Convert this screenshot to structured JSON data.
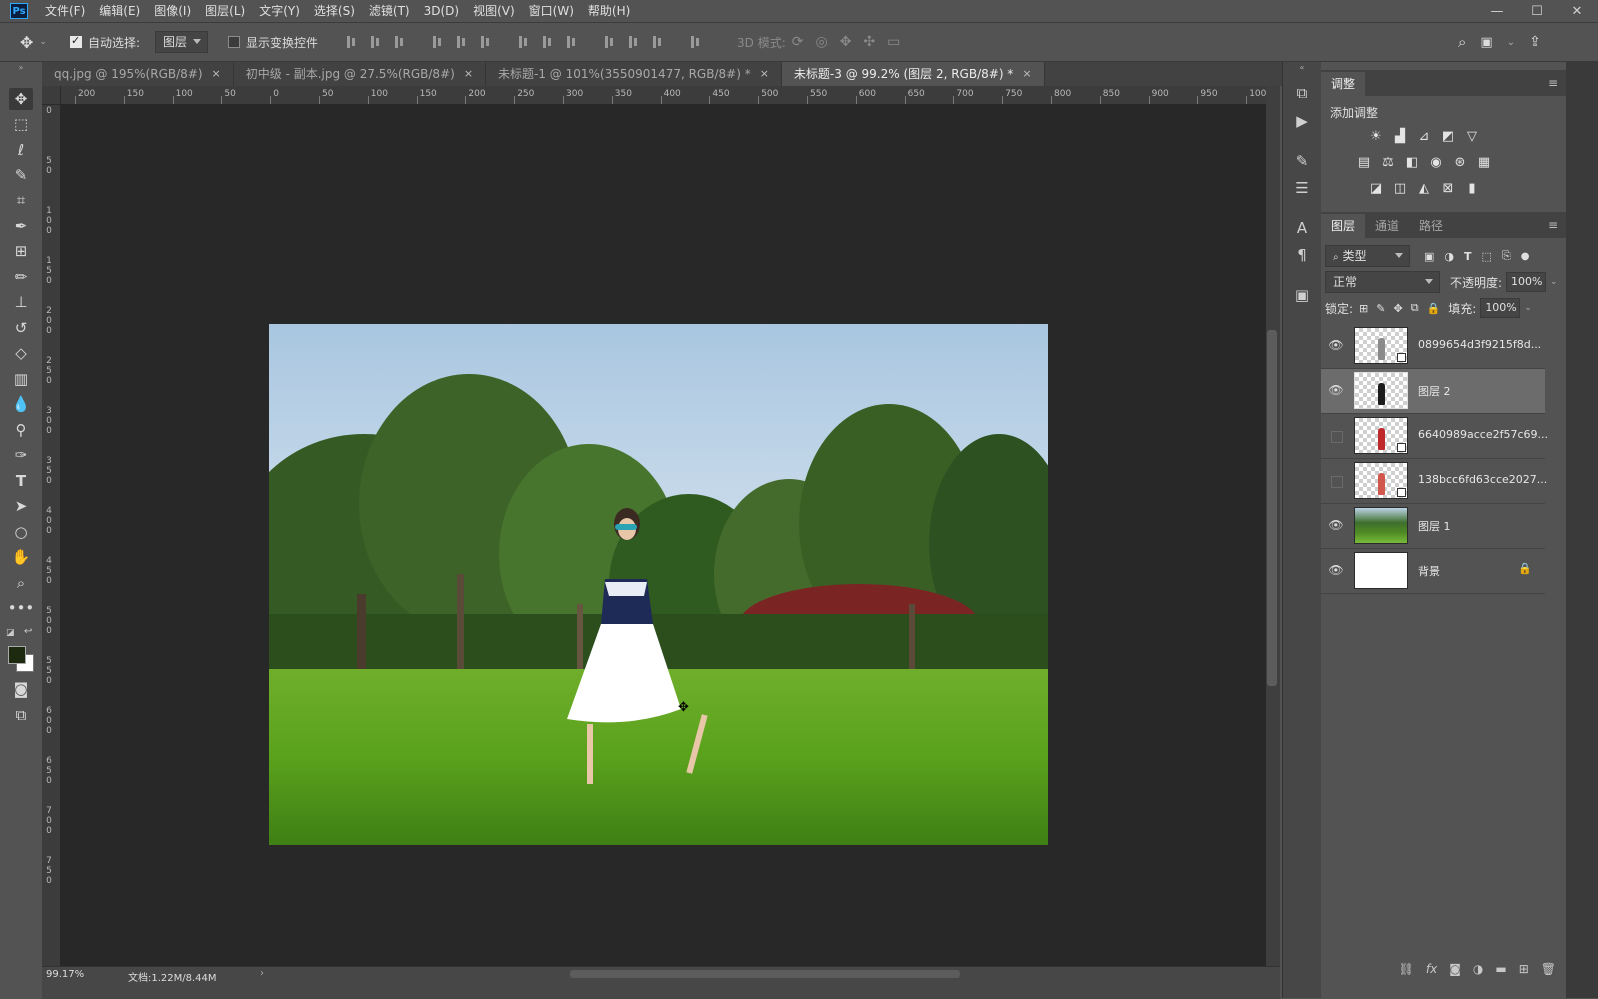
{
  "menubar": {
    "logo": "Ps",
    "items": [
      "文件(F)",
      "编辑(E)",
      "图像(I)",
      "图层(L)",
      "文字(Y)",
      "选择(S)",
      "滤镜(T)",
      "3D(D)",
      "视图(V)",
      "窗口(W)",
      "帮助(H)"
    ],
    "window_controls": [
      "—",
      "☐",
      "✕"
    ]
  },
  "options": {
    "auto_select_label": "自动选择:",
    "auto_select_checked": true,
    "auto_select_target": "图层",
    "show_transform_label": "显示变换控件",
    "show_transform_checked": false,
    "mode_3d_label": "3D 模式:"
  },
  "tabs": [
    {
      "label": "qq.jpg @ 195%(RGB/8#)",
      "close": "×",
      "active": false
    },
    {
      "label": "初中级 - 副本.jpg @ 27.5%(RGB/8#)",
      "close": "×",
      "active": false
    },
    {
      "label": "未标题-1 @ 101%(3550901477, RGB/8#) *",
      "close": "×",
      "active": false
    },
    {
      "label": "未标题-3 @ 99.2% (图层 2, RGB/8#) *",
      "close": "×",
      "active": true
    }
  ],
  "ruler": {
    "top_labels": [
      "200",
      "150",
      "100",
      "50",
      "0",
      "50",
      "100",
      "150",
      "200",
      "250",
      "300",
      "350",
      "400",
      "450",
      "500",
      "550",
      "600",
      "650",
      "700",
      "750",
      "800",
      "850",
      "900",
      "950",
      "100"
    ],
    "left_labels": [
      "0",
      "5\n0",
      "1\n0\n0",
      "1\n5\n0",
      "2\n0\n0",
      "2\n5\n0",
      "3\n0\n0",
      "3\n5\n0",
      "4\n0\n0",
      "4\n5\n0",
      "5\n0\n0",
      "5\n5\n0",
      "6\n0\n0",
      "6\n5\n0",
      "7\n0\n0",
      "7\n5\n0"
    ]
  },
  "status": {
    "zoom": "99.17%",
    "doc_info": "文档:1.22M/8.44M"
  },
  "adjustments_panel": {
    "tab_label": "调整",
    "subtitle": "添加调整",
    "icons_row1": [
      "brightness-icon",
      "levels-icon",
      "curves-icon",
      "exposure-icon",
      "gradient-triangle-icon"
    ],
    "icons_row2": [
      "vibrance-icon",
      "balance-icon",
      "black-white-icon",
      "photo-filter-icon",
      "channel-mixer-icon",
      "color-lookup-icon"
    ],
    "icons_row3": [
      "invert-icon",
      "posterize-icon",
      "threshold-icon",
      "selective-color-icon",
      "gradient-map-icon"
    ]
  },
  "layers_panel": {
    "tabs": [
      "图层",
      "通道",
      "路径"
    ],
    "filter_label": "类型",
    "blend_mode": "正常",
    "opacity_label": "不透明度:",
    "opacity_value": "100%",
    "lock_label": "锁定:",
    "fill_label": "填充:",
    "fill_value": "100%",
    "layers": [
      {
        "name": "0899654d3f9215f8d...",
        "visible": true,
        "selected": false,
        "thumb": "transparent",
        "figure_color": "#8a8a8a",
        "smart": true
      },
      {
        "name": "图层 2",
        "visible": true,
        "selected": true,
        "thumb": "transparent",
        "figure_color": "#1b1b1b",
        "smart": false
      },
      {
        "name": "6640989acce2f57c69...",
        "visible": false,
        "selected": false,
        "thumb": "transparent",
        "figure_color": "#c0282a",
        "smart": true
      },
      {
        "name": "138bcc6fd63cce2027...",
        "visible": false,
        "selected": false,
        "thumb": "transparent",
        "figure_color": "#d2584e",
        "smart": true
      },
      {
        "name": "图层 1",
        "visible": true,
        "selected": false,
        "thumb": "photo",
        "figure_color": "",
        "smart": false
      },
      {
        "name": "背景",
        "visible": true,
        "selected": false,
        "thumb": "plain",
        "figure_color": "",
        "smart": false,
        "locked": true
      }
    ],
    "bottom_icons": [
      "link-icon",
      "fx-icon",
      "mask-icon",
      "adjustment-layer-icon",
      "group-icon",
      "new-layer-icon",
      "trash-icon"
    ]
  },
  "colors": {
    "foreground": "#1e2a10",
    "background": "#ffffff"
  }
}
